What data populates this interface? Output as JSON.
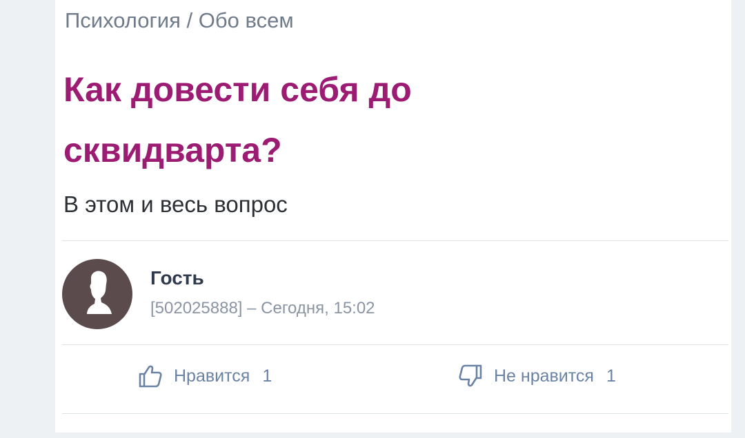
{
  "breadcrumb": "Психология / Обо всем",
  "question": {
    "title": "Как довести себя до сквидварта?",
    "description": "В этом и весь вопрос"
  },
  "author": {
    "name": "Гость",
    "meta": "[502025888] – Сегодня, 15:02",
    "avatar_icon": "user-silhouette-icon"
  },
  "reactions": {
    "like": {
      "label": "Нравится",
      "count": "1",
      "icon": "thumbs-up-icon"
    },
    "dislike": {
      "label": "Не нравится",
      "count": "1",
      "icon": "thumbs-down-icon"
    }
  },
  "colors": {
    "title": "#9c1b73",
    "reaction": "#6a82a3",
    "avatar_bg": "#5b4b4d"
  }
}
